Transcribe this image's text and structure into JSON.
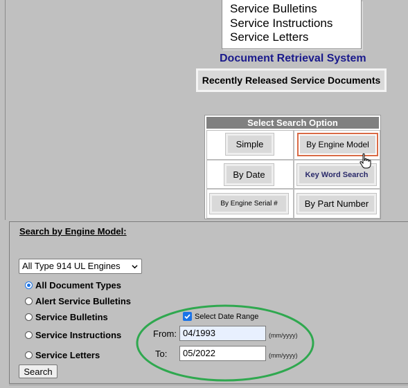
{
  "document_types_list": {
    "items": [
      "Service Bulletins",
      "Service Instructions",
      "Service Letters"
    ]
  },
  "site": {
    "title": "Document Retrieval System",
    "recent_button": "Recently Released Service Documents"
  },
  "search_options": {
    "header": "Select Search Option",
    "simple": "Simple",
    "by_engine_model": "By Engine Model",
    "by_date": "By Date",
    "key_word_search": "Key Word Search",
    "by_engine_serial": "By Engine Serial #",
    "by_part_number": "By Part Number",
    "active": "by_engine_model"
  },
  "search_panel": {
    "title": "Search by Engine Model:",
    "engine_select": {
      "selected": "All Type 914 UL Engines"
    },
    "doc_types": [
      {
        "label": "All Document Types",
        "checked": true
      },
      {
        "label": "Alert Service Bulletins",
        "checked": false
      },
      {
        "label": "Service Bulletins",
        "checked": false
      },
      {
        "label": "Service Instructions",
        "checked": false
      },
      {
        "label": "Service Letters",
        "checked": false
      }
    ],
    "date_range": {
      "checkbox_label": "Select Date Range",
      "checked": true,
      "from_label": "From:",
      "from_value": "04/1993",
      "to_label": "To:",
      "to_value": "05/2022",
      "format_hint": "(mm/yyyy)"
    },
    "search_button": "Search"
  },
  "colors": {
    "page_background": "#c0c0c0",
    "title_blue": "#1a1a8c",
    "active_outline": "#d96a45",
    "highlight_ellipse": "#2fa84f",
    "control_accent": "#1a73e8"
  }
}
